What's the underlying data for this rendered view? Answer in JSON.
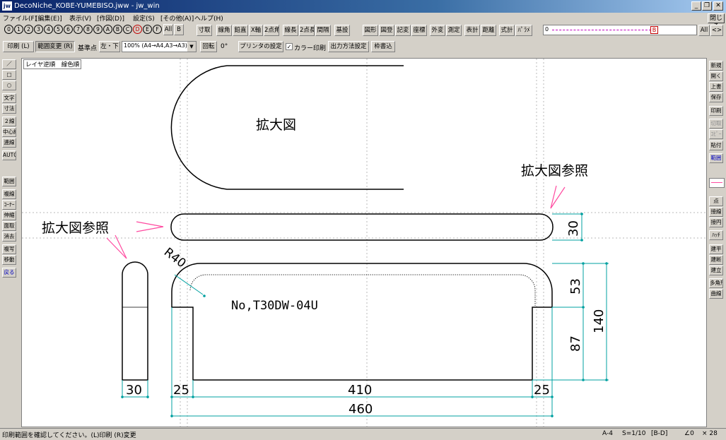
{
  "window": {
    "app_icon": "jw",
    "title": "DecoNiche_KOBE-YUMEBISO.jww - jw_win",
    "close_label": "閉じる"
  },
  "menu": [
    "ファイル(F)",
    "[編集(E)]",
    "表示(V)",
    "[作図(D)]",
    "設定(S)",
    "[その他(A)]",
    "ヘルプ(H)"
  ],
  "layer_buttons": [
    "0",
    "1",
    "2",
    "3",
    "4",
    "5",
    "6",
    "7",
    "8",
    "9",
    "A",
    "B",
    "C",
    "D",
    "E",
    "F"
  ],
  "layer_all": "All",
  "layer_b": "B",
  "toolbar1": [
    "寸取",
    "線角",
    "鉛直",
    "X軸",
    "2点角",
    "線長",
    "2点長",
    "間隔",
    "基設",
    "図形",
    "図登",
    "記変",
    "座標",
    "外変",
    "測定",
    "表計",
    "距離",
    "式計",
    "ﾊﾟﾗﾒ"
  ],
  "layer_group": {
    "first": "0",
    "red": "B",
    "all": "All",
    "arrows": "<>"
  },
  "toolbar2": {
    "print": "印刷 (L)",
    "range_change": "範囲変更 (R)",
    "base_point_label": "基準点",
    "base_point_value": "左・下",
    "scale_select": "100% (A4→A4,A3→A3)",
    "rotate_label": "回転",
    "rotate_value": "0°",
    "printer_settings": "プリンタの設定",
    "color_print_label": "カラー印刷",
    "output_settings": "出力方法設定",
    "frame_write": "枠書込"
  },
  "left_tools": [
    "／",
    "□",
    "○",
    "文字",
    "寸法",
    "２線",
    "中心線",
    "連線",
    "AUTO",
    "範囲",
    "複線",
    "ｺｰﾅｰ",
    "伸縮",
    "面取",
    "消去",
    "複写",
    "移動",
    "戻る"
  ],
  "right_tools": [
    "新規",
    "開く",
    "上書",
    "保存",
    "印刷",
    "切取",
    "ｺﾋﾟｰ",
    "貼付",
    "範囲",
    "点",
    "接線",
    "接円",
    "ﾊｯﾁ",
    "建平",
    "建断",
    "建立",
    "多角形",
    "曲線"
  ],
  "canvas_labels": {
    "layer_order": "レイヤ逆順　線色順",
    "enlarged_view": "拡大図",
    "enlarged_ref_right": "拡大図参照",
    "enlarged_ref_left": "拡大図参照",
    "radius": "R40",
    "part_number": "No,T30DW-04U",
    "dim_height_total": "140",
    "dim_upper": "53",
    "dim_lower": "87",
    "dim_bar_height": "30",
    "dim_side_width": "30",
    "dim_left": "25",
    "dim_middle": "410",
    "dim_right": "25",
    "dim_total_width": "460"
  },
  "status": {
    "message": "印刷範囲を確認してください。(L)印刷 (R)変更",
    "paper": "A-4",
    "scale": "S=1/10",
    "layer": "[B-D]",
    "angle": "∠0",
    "zoom": "× 28"
  },
  "colors": {
    "dimension": "#00a0a0",
    "arrow": "#ff4aa0",
    "guide": "#b0b0b0",
    "title_start": "#0a246a",
    "title_end": "#a6caf0",
    "layer_red": "#c00000"
  }
}
